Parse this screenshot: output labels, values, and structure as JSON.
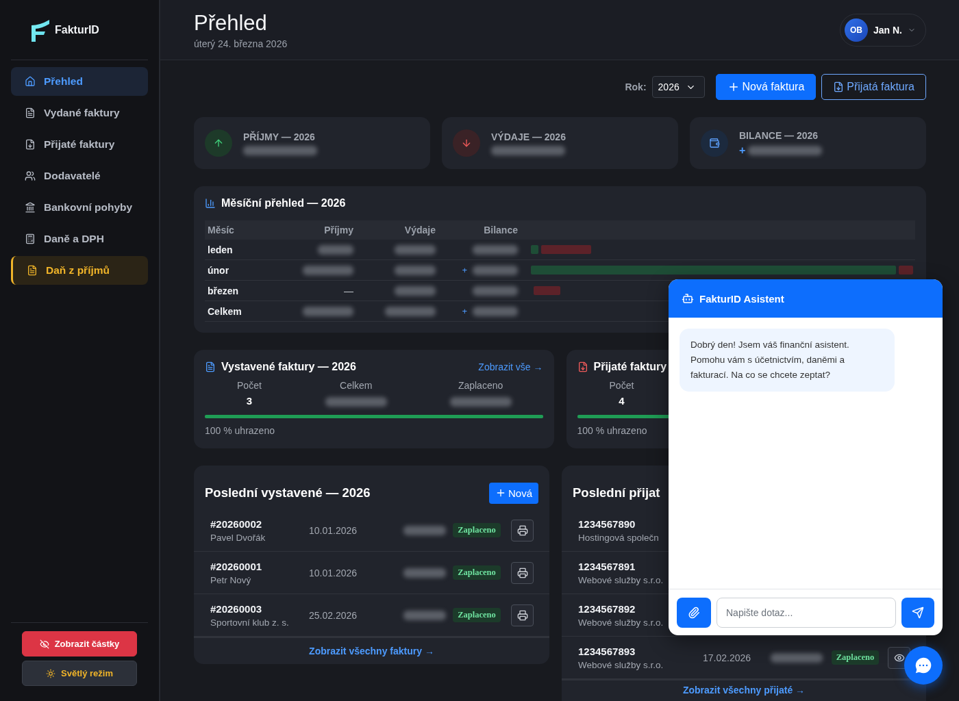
{
  "sidebar": {
    "logo": "FakturID",
    "items": [
      {
        "label": "Přehled",
        "selected": true,
        "kind": "nav"
      },
      {
        "label": "Vydané faktury",
        "selected": false,
        "kind": "nav"
      },
      {
        "label": "Přijaté faktury",
        "selected": false,
        "kind": "nav"
      },
      {
        "label": "Dodavatelé",
        "selected": false,
        "kind": "nav"
      },
      {
        "label": "Bankovní pohyby",
        "selected": false,
        "kind": "nav"
      },
      {
        "label": "Daně a DPH",
        "selected": false,
        "kind": "nav"
      },
      {
        "label": "Daň z příjmů",
        "selected": false,
        "kind": "featured"
      }
    ],
    "buttons": [
      {
        "label": "Zobrazit částky",
        "kind": "danger"
      },
      {
        "label": "Světlý režim",
        "kind": "theme"
      }
    ]
  },
  "header": {
    "title": "Přehled",
    "date": "úterý 24. března 2026",
    "user": {
      "initials": "OB",
      "name": "Jan N."
    }
  },
  "toolbar": {
    "year_label": "Rok:",
    "year": "2026",
    "buttons": [
      {
        "label": "Nová faktura",
        "kind": "primary"
      },
      {
        "label": "Přijatá faktura",
        "kind": "outline"
      }
    ]
  },
  "stats": [
    {
      "label": "PŘÍJMY — 2026",
      "kind": "income"
    },
    {
      "label": "VÝDAJE — 2026",
      "kind": "expense"
    },
    {
      "label": "BILANCE — 2026",
      "kind": "balance",
      "sign": "+"
    }
  ],
  "monthly": {
    "title": "Měsíční přehled — 2026",
    "columns": [
      "Měsíc",
      "Příjmy",
      "Výdaje",
      "Bilance"
    ],
    "rows": [
      {
        "month": "leden"
      },
      {
        "month": "únor",
        "balance_sign": "+"
      },
      {
        "month": "březen",
        "income": "—"
      },
      {
        "month": "Celkem",
        "balance_sign": "+"
      }
    ]
  },
  "summaries": [
    {
      "kind": "issued",
      "title": "Vystavené faktury — 2026",
      "link": "Zobrazit vše →",
      "stats": [
        {
          "label": "Počet",
          "value": "3"
        },
        {
          "label": "Celkem"
        },
        {
          "label": "Zaplaceno"
        }
      ],
      "level": 1,
      "paid_text": "100 % uhrazeno"
    },
    {
      "kind": "received",
      "title": "Přijaté faktury",
      "stats": [
        {
          "label": "Počet",
          "value": "4"
        }
      ],
      "level": 1,
      "paid_text": "100 % uhrazeno"
    }
  ],
  "recent": [
    {
      "kind": "issued",
      "title": "Poslední vystavené — 2026",
      "new_button": "Nová",
      "rows": [
        {
          "number": "#20260002",
          "party": "Pavel Dvořák",
          "date": "10.01.2026",
          "status": "Zaplaceno"
        },
        {
          "number": "#20260001",
          "party": "Petr Nový",
          "date": "10.01.2026",
          "status": "Zaplaceno"
        },
        {
          "number": "#20260003",
          "party": "Sportovní klub z. s.",
          "date": "25.02.2026",
          "status": "Zaplaceno"
        }
      ],
      "footer_link": "Zobrazit všechny faktury →"
    },
    {
      "kind": "received",
      "title": "Poslední přijat",
      "rows": [
        {
          "number": "1234567890",
          "party": "Hostingová společn"
        },
        {
          "number": "1234567891",
          "party": "Webové služby s.r.o."
        },
        {
          "number": "1234567892",
          "party": "Webové služby s.r.o."
        },
        {
          "number": "1234567893",
          "party": "Webové služby s.r.o.",
          "date": "17.02.2026",
          "status": "Zaplaceno"
        }
      ],
      "footer_link": "Zobrazit všechny přijaté →"
    }
  ],
  "chat": {
    "title": "FakturID Asistent",
    "messages": [
      {
        "text": "Dobrý den! Jsem váš finanční asistent. Pomohu vám s účetnictvím, daněmi a fakturací. Na co se chcete zeptat?"
      }
    ],
    "input": {
      "placeholder": "Napište dotaz..."
    }
  }
}
